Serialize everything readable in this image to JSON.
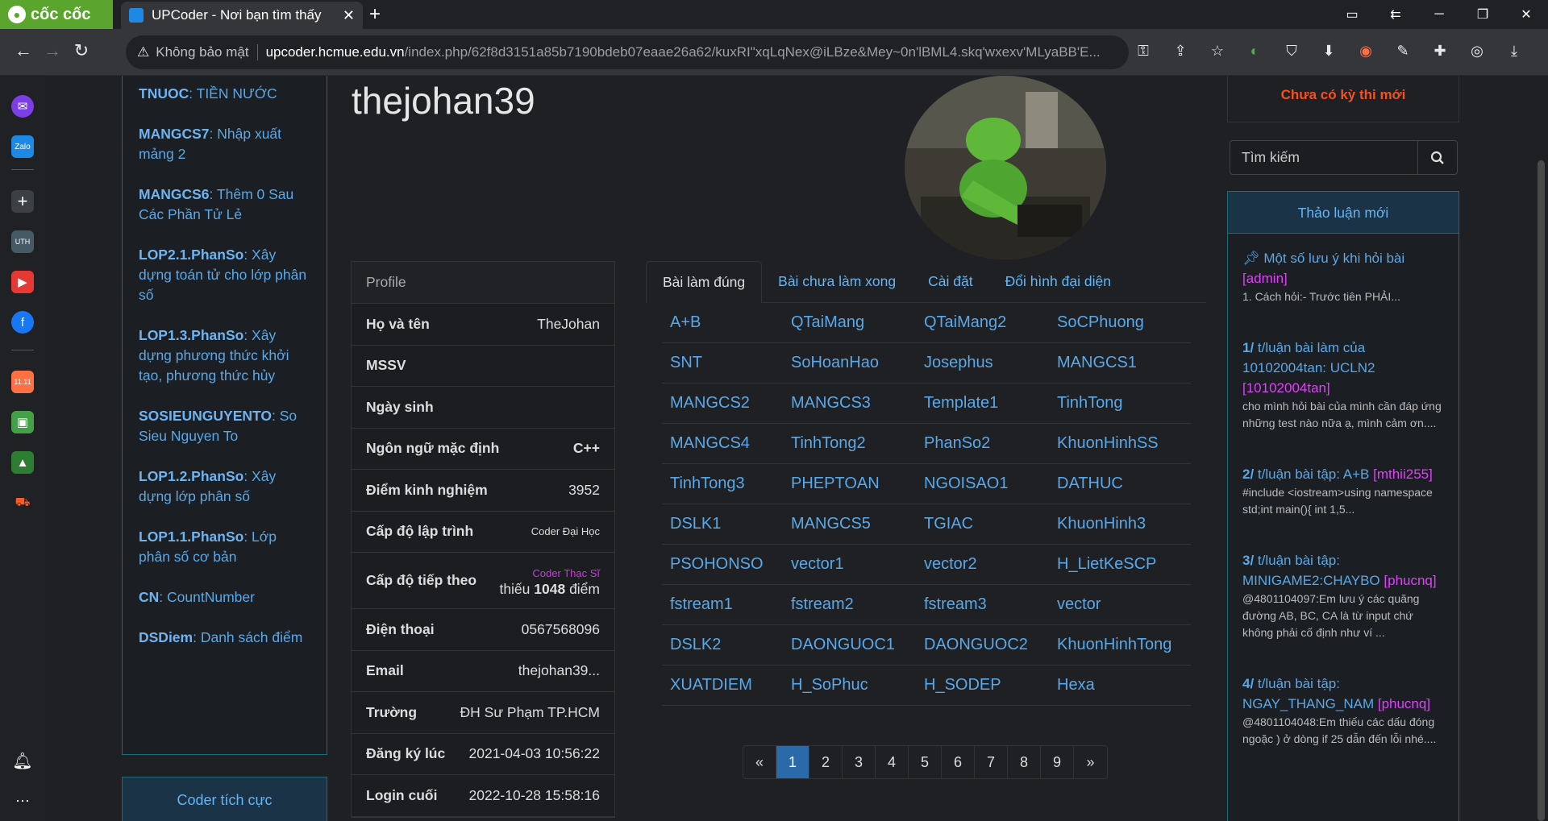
{
  "browser": {
    "brand": "cốc cốc",
    "tab_title": "UPCoder - Nơi bạn tìm thấy",
    "security_label": "Không bảo mật",
    "url_host": "upcoder.hcmue.edu.vn",
    "url_path": "/index.php/62f8d3151a85b7190bdeb07eaae26a62/kuxRI\"xqLqNex@iLBze&Mey~0n'lBML4.skq'wxexv'MLyaBB'E..."
  },
  "left_list": [
    {
      "code": "TNUOC",
      "name": ": TIỀN NƯỚC"
    },
    {
      "code": "MANGCS7",
      "name": ": Nhập xuất mảng 2"
    },
    {
      "code": "MANGCS6",
      "name": ": Thêm 0 Sau Các Phần Tử Lẻ"
    },
    {
      "code": "LOP2.1.PhanSo",
      "name": ": Xây dựng toán tử cho lớp phân số"
    },
    {
      "code": "LOP1.3.PhanSo",
      "name": ": Xây dựng phương thức khởi tạo, phương thức hủy"
    },
    {
      "code": "SOSIEUNGUYENTO",
      "name": ": So Sieu Nguyen To"
    },
    {
      "code": "LOP1.2.PhanSo",
      "name": ": Xây dựng lớp phân số"
    },
    {
      "code": "LOP1.1.PhanSo",
      "name": ": Lớp phân số cơ bản"
    },
    {
      "code": "CN",
      "name": ": CountNumber"
    },
    {
      "code": "DSDiem",
      "name": ": Danh sách điểm"
    }
  ],
  "coder_tich_cuc": "Coder tích cực",
  "username": "thejohan39",
  "profile": {
    "header": "Profile",
    "rows": [
      {
        "k": "Họ và tên",
        "v": "TheJohan"
      },
      {
        "k": "MSSV",
        "v": ""
      },
      {
        "k": "Ngày sinh",
        "v": ""
      },
      {
        "k": "Ngôn ngữ mặc định",
        "v": "C++"
      },
      {
        "k": "Điểm kinh nghiệm",
        "v": "3952"
      },
      {
        "k": "Cấp độ lập trình",
        "v": "Coder Đại Học"
      }
    ],
    "next_level_key": "Cấp độ tiếp theo",
    "next_level_name": "Coder Thạc Sĩ",
    "next_level_pre": "thiếu ",
    "next_level_points": "1048",
    "next_level_post": " điểm",
    "rows2": [
      {
        "k": "Điện thoại",
        "v": "0567568096"
      },
      {
        "k": "Email",
        "v": "thejohan39..."
      },
      {
        "k": "Trường",
        "v": "ĐH Sư Phạm TP.HCM"
      },
      {
        "k": "Đăng ký lúc",
        "v": "2021-04-03 10:56:22"
      },
      {
        "k": "Login cuối",
        "v": "2022-10-28 15:58:16"
      }
    ]
  },
  "tabs": [
    "Bài làm đúng",
    "Bài chưa làm xong",
    "Cài đặt",
    "Đổi hình đại diện"
  ],
  "problems": [
    [
      "A+B",
      "QTaiMang",
      "QTaiMang2",
      "SoCPhuong"
    ],
    [
      "SNT",
      "SoHoanHao",
      "Josephus",
      "MANGCS1"
    ],
    [
      "MANGCS2",
      "MANGCS3",
      "Template1",
      "TinhTong"
    ],
    [
      "MANGCS4",
      "TinhTong2",
      "PhanSo2",
      "KhuonHinhSS"
    ],
    [
      "TinhTong3",
      "PHEPTOAN",
      "NGOISAO1",
      "DATHUC"
    ],
    [
      "DSLK1",
      "MANGCS5",
      "TGIAC",
      "KhuonHinh3"
    ],
    [
      "PSOHONSO",
      "vector1",
      "vector2",
      "H_LietKeSCP"
    ],
    [
      "fstream1",
      "fstream2",
      "fstream3",
      "vector"
    ],
    [
      "DSLK2",
      "DAONGUOC1",
      "DAONGUOC2",
      "KhuonHinhTong"
    ],
    [
      "XUATDIEM",
      "H_SoPhuc",
      "H_SODEP",
      "Hexa"
    ]
  ],
  "pager": [
    "«",
    "1",
    "2",
    "3",
    "4",
    "5",
    "6",
    "7",
    "8",
    "9",
    "»"
  ],
  "pager_current": "1",
  "contest_notice": "Chưa có kỳ thi mới",
  "search_placeholder": "Tìm kiếm",
  "discussion": {
    "header": "Thảo luận mới",
    "posts": [
      {
        "num": "",
        "title": "Một số lưu ý khi hỏi bài",
        "author": "[admin]",
        "snippet": "1. Cách hỏi:- Trước tiên PHẢI..."
      },
      {
        "num": "1/",
        "title": " t/luận bài làm của 10102004tan: UCLN2",
        "author": "[10102004tan]",
        "snippet": "cho mình hỏi bài của mình cần đáp ứng những test nào nữa ạ, mình cảm ơn...."
      },
      {
        "num": "2/",
        "title": " t/luận bài tập: A+B",
        "author": "[mthii255]",
        "snippet": "#include <iostream>using namespace std;int main(){ int 1,5..."
      },
      {
        "num": "3/",
        "title": " t/luận bài tập: MINIGAME2:CHAYBO",
        "author": "[phucnq]",
        "snippet": "@4801104097:Em lưu ý các quãng đường AB, BC, CA là từ input chứ không phải cố định như ví ..."
      },
      {
        "num": "4/",
        "title": " t/luận bài tập: NGAY_THANG_NAM",
        "author": "[phucnq]",
        "snippet": "@4801104048:Em thiếu các dấu đóng ngoặc ) ở dòng if 25 dẫn đến lỗi nhé...."
      }
    ]
  }
}
